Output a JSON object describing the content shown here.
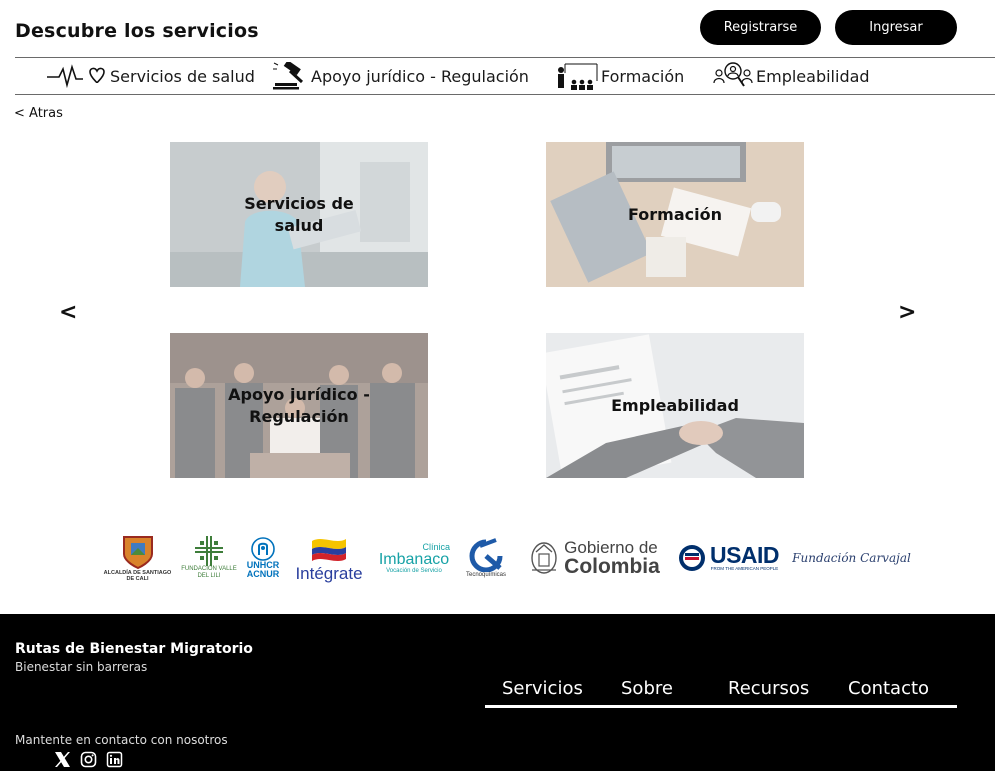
{
  "header": {
    "title": "Descubre los servicios",
    "register_label": "Registrarse",
    "login_label": "Ingresar"
  },
  "nav": [
    {
      "label": "Servicios de salud",
      "icon": "heartbeat-icon"
    },
    {
      "label": "Apoyo jurídico - Regulación",
      "icon": "gavel-icon"
    },
    {
      "label": "Formación",
      "icon": "teacher-icon"
    },
    {
      "label": "Empleabilidad",
      "icon": "people-search-icon"
    }
  ],
  "back_label": "<  Atras",
  "carousel": {
    "prev": "<",
    "next": ">",
    "cards": [
      {
        "label": "Servicios de salud"
      },
      {
        "label": "Formación"
      },
      {
        "label": "Apoyo jurídico - Regulación"
      },
      {
        "label": "Empleabilidad"
      }
    ]
  },
  "partners": {
    "alcaldia": "ALCALDÍA DE SANTIAGO DE CALI",
    "lili": "FUNDACIÓN VALLE DEL LILI",
    "acnur": [
      "UNHCR",
      "ACNUR"
    ],
    "integrate": "Intégrate",
    "imbanaco_top": "Clínica",
    "imbanaco": "Imbanaco",
    "imbanaco_sub": "Vocación de Servicio",
    "tecno": "Tecnoquímicas",
    "gob_top": "Gobierno de",
    "gob_bottom": "Colombia",
    "usaid": "USAID",
    "usaid_sub": "FROM THE AMERICAN PEOPLE",
    "carvajal": "Fundación Carvajal"
  },
  "footer": {
    "title": "Rutas de Bienestar Migratorio",
    "tagline": "Bienestar sin barreras",
    "links": [
      "Servicios",
      "Sobre",
      "Recursos",
      "Contacto"
    ],
    "contact": "Mantente en contacto con nosotros",
    "social": [
      "x-icon",
      "instagram-icon",
      "linkedin-icon"
    ]
  },
  "colors": {
    "accent": "#000000",
    "usaid_blue": "#002f6c",
    "usaid_red": "#c8102e",
    "integrate_blue": "#2a3f9e",
    "imbanaco_teal": "#17a2a6",
    "tecno_blue": "#1e5aa8"
  }
}
